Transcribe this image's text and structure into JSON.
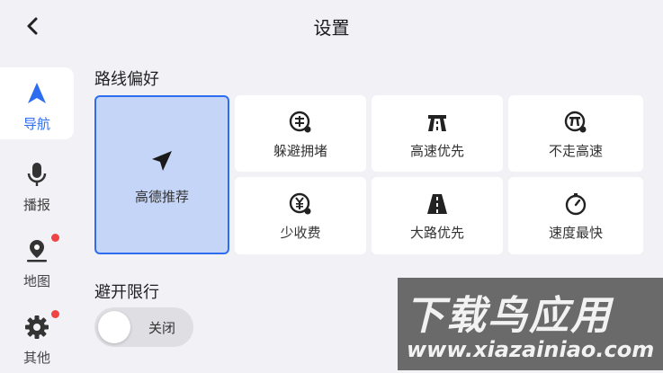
{
  "header": {
    "title": "设置",
    "back_icon": "chevron-left-icon"
  },
  "sidebar": {
    "items": [
      {
        "label": "导航",
        "icon": "navigation-arrow-icon",
        "active": true,
        "badge": false
      },
      {
        "label": "播报",
        "icon": "microphone-icon",
        "active": false,
        "badge": false
      },
      {
        "label": "地图",
        "icon": "map-pin-icon",
        "active": false,
        "badge": true
      },
      {
        "label": "其他",
        "icon": "gear-icon",
        "active": false,
        "badge": true
      }
    ]
  },
  "route_preference": {
    "title": "路线偏好",
    "options": [
      {
        "label": "高德推荐",
        "icon": "paper-plane-icon",
        "selected": true
      },
      {
        "label": "躲避拥堵",
        "icon": "avoid-congestion-icon",
        "selected": false
      },
      {
        "label": "高速优先",
        "icon": "highway-icon",
        "selected": false
      },
      {
        "label": "不走高速",
        "icon": "no-highway-icon",
        "selected": false
      },
      {
        "label": "少收费",
        "icon": "toll-yen-icon",
        "selected": false
      },
      {
        "label": "大路优先",
        "icon": "main-road-icon",
        "selected": false
      },
      {
        "label": "速度最快",
        "icon": "speedometer-icon",
        "selected": false
      }
    ]
  },
  "restriction": {
    "title": "避开限行",
    "toggle_label": "关闭",
    "enabled": false
  },
  "watermark": {
    "line1": "下载鸟应用",
    "line2": "www.xiazainiao.com"
  },
  "colors": {
    "accent": "#2f6df0",
    "badge": "#ee4444",
    "selected_fill": "#c5d5f7"
  }
}
